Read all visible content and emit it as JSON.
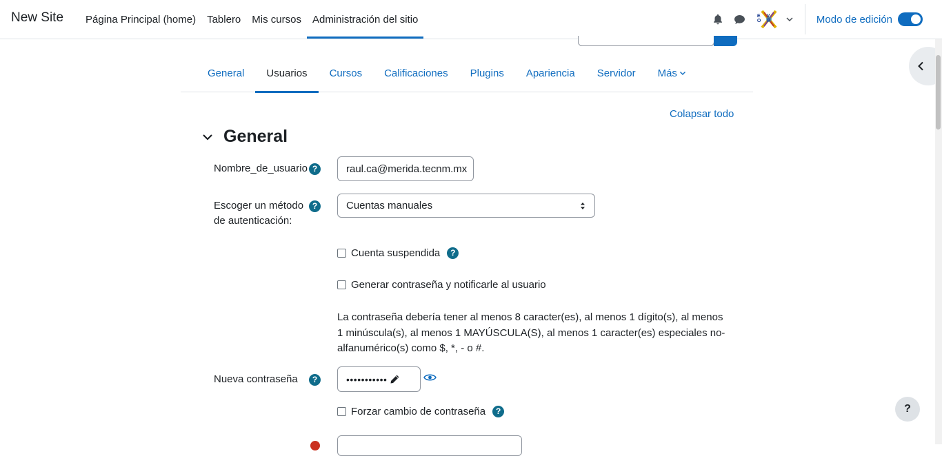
{
  "header": {
    "brand": "New Site",
    "nav": [
      {
        "label": "Página Principal (home)",
        "active": false
      },
      {
        "label": "Tablero",
        "active": false
      },
      {
        "label": "Mis cursos",
        "active": false
      },
      {
        "label": "Administración del sitio",
        "active": true
      }
    ],
    "icons": [
      "bell-icon",
      "chat-icon"
    ],
    "avatar_text": "EV OP",
    "edit_mode_label": "Modo de edición",
    "edit_mode_on": true
  },
  "tabs": [
    {
      "label": "General",
      "active": false
    },
    {
      "label": "Usuarios",
      "active": true
    },
    {
      "label": "Cursos",
      "active": false
    },
    {
      "label": "Calificaciones",
      "active": false
    },
    {
      "label": "Plugins",
      "active": false
    },
    {
      "label": "Apariencia",
      "active": false
    },
    {
      "label": "Servidor",
      "active": false
    },
    {
      "label": "Más",
      "active": false
    }
  ],
  "collapse_all": "Colapsar todo",
  "section": {
    "title": "General"
  },
  "form": {
    "username": {
      "label": "Nombre_de_usuario",
      "value": "raul.ca@merida.tecnm.mx"
    },
    "auth": {
      "label_line1": "Escoger un método",
      "label_line2": "de autenticación:",
      "value": "Cuentas manuales"
    },
    "suspended": {
      "label": "Cuenta suspendida",
      "checked": false
    },
    "generate_password": {
      "label": "Generar contraseña y notificarle al usuario",
      "checked": false
    },
    "policy_text": "La contraseña debería tener al menos 8 caracter(es), al menos 1 dígito(s), al menos 1 minúscula(s), al menos 1 MAYÚSCULA(S), al menos 1 caracter(es) especiales no-alfanumérico(s) como $, *, - o #.",
    "new_password": {
      "label": "Nueva contraseña",
      "masked": "•••••••••••"
    },
    "force_change": {
      "label": "Forzar cambio de contraseña",
      "checked": false
    }
  },
  "help_button": "?",
  "help_icon_glyph": "?"
}
